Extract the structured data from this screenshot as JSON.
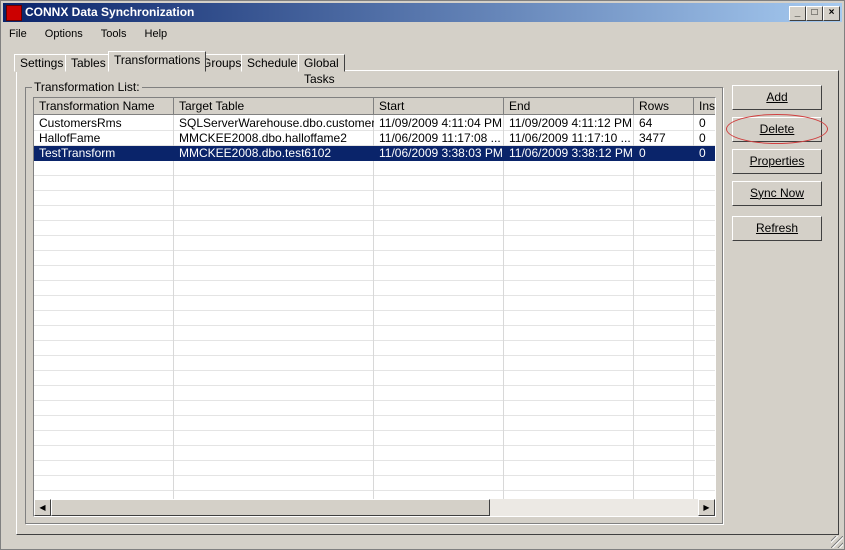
{
  "window": {
    "title": "CONNX Data Synchronization",
    "minimize": "_",
    "maximize": "□",
    "close": "×"
  },
  "menu": [
    "File",
    "Options",
    "Tools",
    "Help"
  ],
  "tabs": [
    "Settings",
    "Tables",
    "Transformations",
    "Groups",
    "Schedule",
    "Global Tasks"
  ],
  "active_tab": "Transformations",
  "group_label": "Transformation List:",
  "columns": [
    "Transformation Name",
    "Target Table",
    "Start",
    "End",
    "Rows",
    "Inse"
  ],
  "rows": [
    [
      "CustomersRms",
      "SQLServerWarehouse.dbo.customers...",
      "11/09/2009 4:11:04 PM",
      "11/09/2009 4:11:12 PM",
      "64",
      "0"
    ],
    [
      "HallofFame",
      "MMCKEE2008.dbo.halloffame2",
      "11/06/2009 11:17:08 ...",
      "11/06/2009 11:17:10 ...",
      "3477",
      "0"
    ],
    [
      "TestTransform",
      "MMCKEE2008.dbo.test6102",
      "11/06/2009 3:38:03 PM",
      "11/06/2009 3:38:12 PM",
      "0",
      "0"
    ]
  ],
  "selected_row": 2,
  "buttons": {
    "add": "Add",
    "delete": "Delete",
    "properties": "Properties",
    "sync_now": "Sync Now",
    "refresh": "Refresh"
  },
  "highlight_color": "#0a246a"
}
